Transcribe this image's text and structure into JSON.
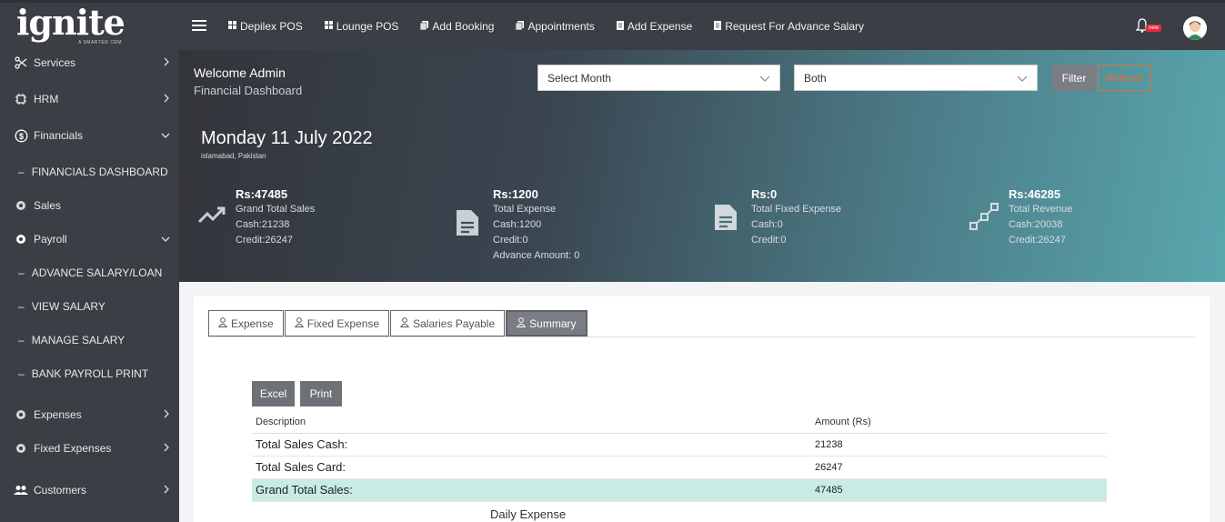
{
  "app": {
    "logo_text_main": "ignite",
    "logo_text_sub": "A SMARTER CRM"
  },
  "sidebar": {
    "items": [
      {
        "label": "Services",
        "icon": "scissors-icon"
      },
      {
        "label": "HRM",
        "icon": "chip-icon"
      },
      {
        "label": "Financials",
        "icon": "dollar-circle-icon"
      },
      {
        "label": "Sales",
        "icon": "gear-icon"
      },
      {
        "label": "Payroll",
        "icon": "gear-icon"
      },
      {
        "label": "Expenses",
        "icon": "gear-icon"
      },
      {
        "label": "Fixed Expenses",
        "icon": "gear-icon"
      },
      {
        "label": "Customers",
        "icon": "users-icon"
      }
    ],
    "sub_financials": "FINANCIALS DASHBOARD",
    "sub_payroll": [
      "ADVANCE SALARY/LOAN",
      "VIEW SALARY",
      "MANAGE SALARY",
      "BANK PAYROLL PRINT"
    ]
  },
  "topbar": {
    "links": [
      {
        "label": "Depilex POS",
        "icon": "grid-icon"
      },
      {
        "label": "Lounge POS",
        "icon": "grid-icon"
      },
      {
        "label": "Add Booking",
        "icon": "copy-icon"
      },
      {
        "label": "Appointments",
        "icon": "copy-icon"
      },
      {
        "label": "Add Expense",
        "icon": "receipt-icon"
      },
      {
        "label": "Request For Advance Salary",
        "icon": "receipt-icon"
      }
    ],
    "badge": "new"
  },
  "hero": {
    "welcome": "Welcome Admin",
    "subtitle": "Financial Dashboard",
    "month_select": "Select Month",
    "type_select": "Both",
    "filter_label": "Filter",
    "refresh_label": "Refresh",
    "date": "Monday 11 July 2022",
    "location": "islamabad, Pakistan"
  },
  "stats": [
    {
      "value": "Rs:47485",
      "title": "Grand Total Sales",
      "lines": [
        "Cash:21238",
        "Credit:26247"
      ],
      "icon": "trending-up-icon"
    },
    {
      "value": "Rs:1200",
      "title": "Total Expense",
      "lines": [
        "Cash:1200",
        "Credit:0",
        "Advance Amount: 0"
      ],
      "icon": "document-icon"
    },
    {
      "value": "Rs:0",
      "title": "Total Fixed Expense",
      "lines": [
        "Cash:0",
        "Credit:0"
      ],
      "icon": "document-icon"
    },
    {
      "value": "Rs:46285",
      "title": "Total Revenue",
      "lines": [
        "Cash:20038",
        "Credit:26247"
      ],
      "icon": "network-icon"
    }
  ],
  "tabs": [
    "Expense",
    "Fixed Expense",
    "Salaries Payable",
    "Summary"
  ],
  "actions": {
    "excel": "Excel",
    "print": "Print"
  },
  "table": {
    "headers": [
      "Description",
      "Amount (Rs)"
    ],
    "rows": [
      {
        "description": "Total Sales Cash:",
        "amount": "21238"
      },
      {
        "description": "Total Sales Card:",
        "amount": "26247"
      },
      {
        "description": "Grand Total Sales:",
        "amount": "47485"
      }
    ]
  },
  "section_title": "Daily Expense",
  "colors": {
    "sidebar": "#3b3e44",
    "accent": "#5aa7ae",
    "refresh": "#e0703a",
    "highlight_row": "#c8ece4"
  }
}
